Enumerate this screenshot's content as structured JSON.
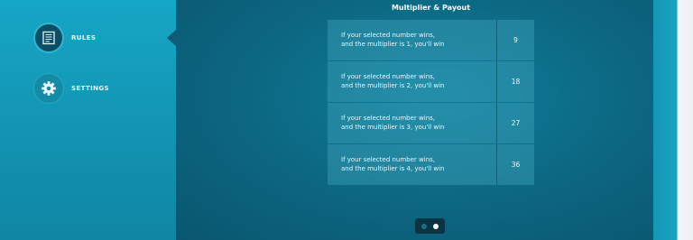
{
  "sidebar": {
    "items": [
      {
        "label": "RULES",
        "icon": "rules-document-icon",
        "selected": true
      },
      {
        "label": "SETTINGS",
        "icon": "gear-icon",
        "selected": false
      }
    ]
  },
  "main": {
    "title": "Multiplier & Payout",
    "rows": [
      {
        "line1": "If your selected number wins,",
        "line2": "and the multiplier is 1, you'll win",
        "payout": "9"
      },
      {
        "line1": "If your selected number wins,",
        "line2": "and the multiplier is 2, you'll win",
        "payout": "18"
      },
      {
        "line1": "If your selected number wins,",
        "line2": "and the multiplier is 3, you'll win",
        "payout": "27"
      },
      {
        "line1": "If your selected number wins,",
        "line2": "and the multiplier is 4, you'll win",
        "payout": "36"
      }
    ]
  },
  "pager": {
    "pages": 2,
    "current_page": 2
  },
  "colors": {
    "accent": "#2fb6d3",
    "sidebar": "#16a6c6",
    "panel_bg": "#0c6680"
  }
}
